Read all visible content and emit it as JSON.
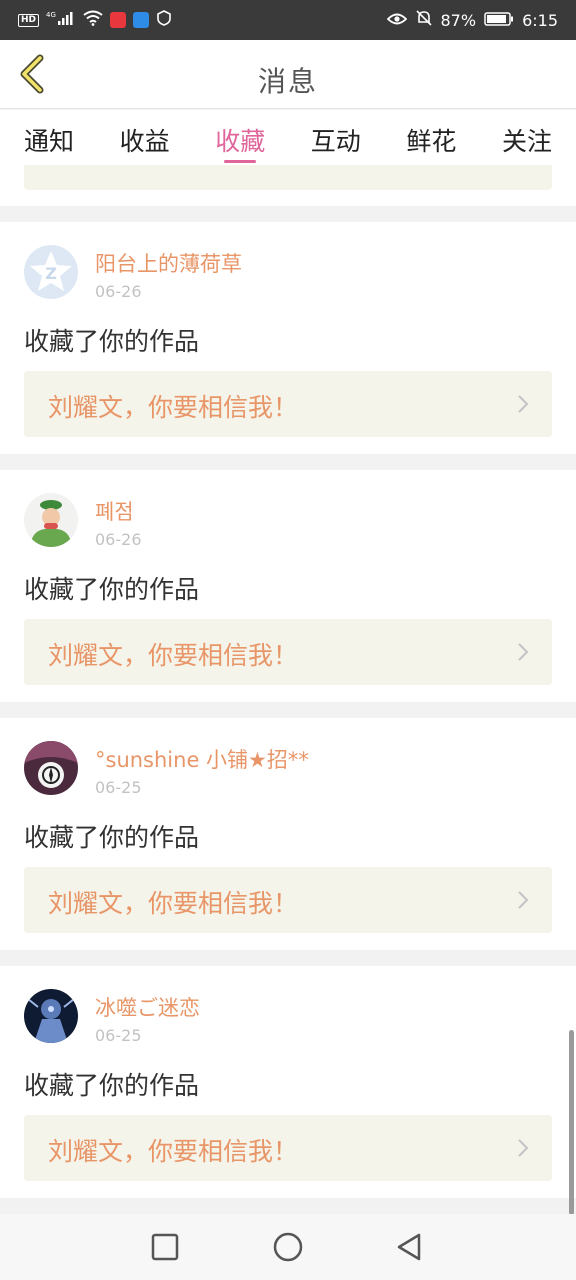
{
  "status_bar": {
    "net_hd": "HD",
    "net_4g": "4G",
    "battery": "87%",
    "time": "6:15"
  },
  "header": {
    "title": "消息",
    "back_icon": "chevron-left-icon"
  },
  "tabs": [
    {
      "label": "通知",
      "active": false
    },
    {
      "label": "收益",
      "active": false
    },
    {
      "label": "收藏",
      "active": true
    },
    {
      "label": "互动",
      "active": false
    },
    {
      "label": "鲜花",
      "active": false
    },
    {
      "label": "关注",
      "active": false
    }
  ],
  "messages": [
    {
      "user": "阳台上的薄荷草",
      "date": "06-26",
      "action": "收藏了你的作品",
      "work_title": "刘耀文，你要相信我！"
    },
    {
      "user": "폐점",
      "date": "06-26",
      "action": "收藏了你的作品",
      "work_title": "刘耀文，你要相信我！"
    },
    {
      "user": "°sunshine 小铺★招**",
      "date": "06-25",
      "action": "收藏了你的作品",
      "work_title": "刘耀文，你要相信我！"
    },
    {
      "user": "冰噬ご迷恋",
      "date": "06-25",
      "action": "收藏了你的作品",
      "work_title": "刘耀文，你要相信我！"
    }
  ],
  "colors": {
    "accent": "#e0659a",
    "username": "#e89668",
    "card_box": "#f5f4ea"
  }
}
